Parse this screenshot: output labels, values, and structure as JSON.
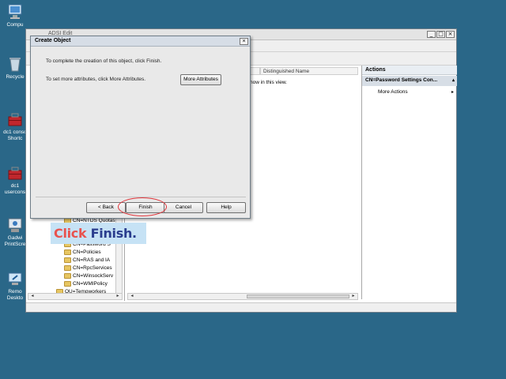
{
  "desktop": {
    "icons": [
      {
        "label": "Compu",
        "icon": "computer-icon"
      },
      {
        "label": "Recycle",
        "icon": "recycle-bin-icon"
      },
      {
        "label": "dc1 conso",
        "label2": "Shortc",
        "icon": "toolbox-icon"
      },
      {
        "label": "dc1",
        "label2": "usercons",
        "icon": "toolbox-icon"
      },
      {
        "label": "Gadwi",
        "label2": "PrintScre",
        "icon": "printscreen-icon"
      },
      {
        "label": "Remo",
        "label2": "Deskto",
        "icon": "remote-desktop-icon"
      }
    ]
  },
  "main_window": {
    "title": "ADSI Edit",
    "list_columns": [
      "Distinguished Name"
    ],
    "list_message": "now in this view.",
    "tree_items": [
      "CN=NTDS Quotas",
      "CN=Password S",
      "CN=Policies",
      "CN=RAS and IA",
      "CN=RpcServices",
      "CN=WinsockServ",
      "CN=WMIPolicy",
      "OU=Tempworkers"
    ],
    "actions": {
      "header": "Actions",
      "section": "CN=Password Settings Con...",
      "more_actions": "More Actions"
    }
  },
  "dialog": {
    "title": "Create Object",
    "line1": "To complete the creation of this object, click Finish.",
    "line2": "To set more attributes, click More Attributes.",
    "more_attributes_label": "More Attributes",
    "back_label": "< Back",
    "finish_label": "Finish",
    "cancel_label": "Cancel",
    "help_label": "Help"
  },
  "callout": {
    "word1": "Click",
    "word2": "Finish."
  },
  "colors": {
    "desktop": "#2a6788",
    "highlight_ring": "#e0343a",
    "callout_bg": "#c6e2f5"
  }
}
